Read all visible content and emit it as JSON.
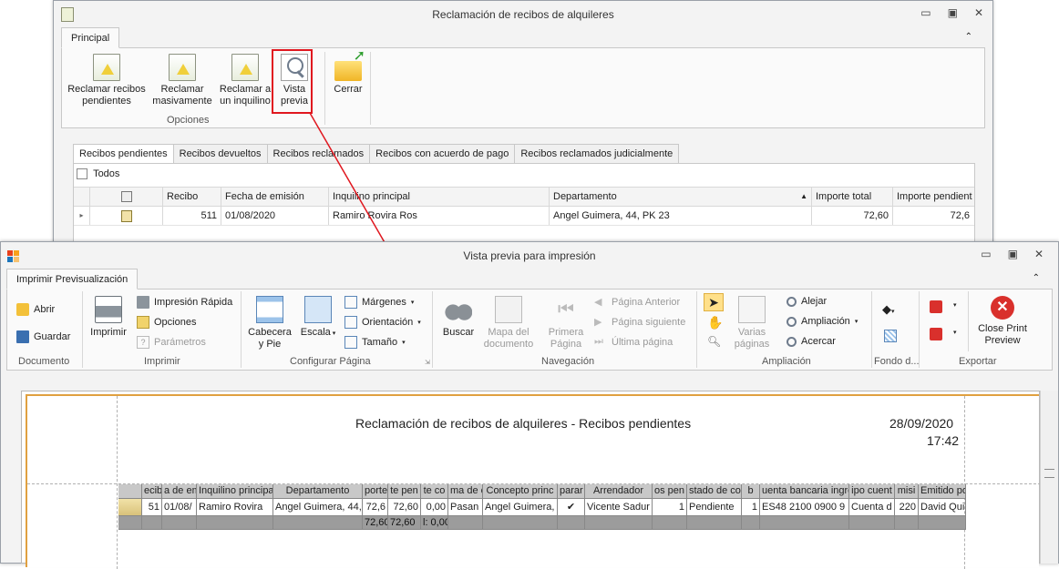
{
  "win1": {
    "title": "Reclamación de recibos  de alquileres",
    "tab": "Principal",
    "buttons": {
      "reclamar_pend": "Reclamar recibos pendientes",
      "reclamar_masivo": "Reclamar masivamente",
      "reclamar_inquilino": "Reclamar a un inquilino",
      "vista_previa": "Vista previa",
      "cerrar": "Cerrar"
    },
    "group": "Opciones",
    "subtabs": [
      "Recibos pendientes",
      "Recibos devueltos",
      "Recibos reclamados",
      "Recibos con acuerdo de pago",
      "Recibos reclamados judicialmente"
    ],
    "todos": "Todos",
    "columns": [
      "Recibo",
      "Fecha de emisión",
      "Inquilino principal",
      "Departamento",
      "Importe total",
      "Importe pendient"
    ],
    "sort_icon": "▲",
    "row": {
      "recibo": "511",
      "fecha": "01/08/2020",
      "inquilino": "Ramiro Rovira Ros",
      "departamento": "Angel Guimera, 44, PK 23",
      "importe_total": "72,60",
      "importe_pendiente": "72,6"
    }
  },
  "win2": {
    "title": "Vista previa para impresión",
    "tab": "Imprimir Previsualización",
    "documento": {
      "abrir": "Abrir",
      "guardar": "Guardar",
      "label": "Documento"
    },
    "imprimir": {
      "imprimir": "Imprimir",
      "rapida": "Impresión Rápida",
      "opciones": "Opciones",
      "parametros": "Parámetros",
      "label": "Imprimir"
    },
    "configurar": {
      "cabecera": "Cabecera y Pie",
      "escala": "Escala",
      "margenes": "Márgenes",
      "orientacion": "Orientación",
      "tamano": "Tamaño",
      "label": "Configurar Página"
    },
    "navegacion": {
      "buscar": "Buscar",
      "mapa": "Mapa del documento",
      "primera": "Primera Página",
      "anterior": "Página Anterior",
      "siguiente": "Página siguiente",
      "ultima": "Última página",
      "label": "Navegación"
    },
    "ampliacion": {
      "varias": "Varias páginas",
      "alejar": "Alejar",
      "ampliacion": "Ampliación",
      "acercar": "Acercar",
      "label": "Ampliación"
    },
    "fondo": {
      "label": "Fondo d..."
    },
    "exportar": {
      "close": "Close Print Preview",
      "label": "Exportar"
    }
  },
  "report": {
    "title": "Reclamación de recibos de alquileres - Recibos pendientes",
    "date": "28/09/2020",
    "time": "17:42",
    "headers": [
      "",
      "ecib",
      "a de em",
      "Inquilino principa",
      "Departamento",
      "porte t",
      "te pen",
      "te co",
      "ma de c",
      "Concepto princ",
      "parar fa",
      "Arrendador",
      "os pen",
      "stado de co",
      "b",
      "uenta bancaria ingre",
      "ipo cuent",
      "misi",
      "Emitido po"
    ],
    "row": [
      "",
      "51",
      "01/08/",
      "Ramiro Rovira",
      "Angel Guimera, 44,",
      "72,6",
      "72,60",
      "0,00",
      "Pasan",
      "Angel Guimera,",
      "✔",
      "Vicente Sadur",
      "1",
      "Pendiente",
      "1",
      "ES48 2100 0900 9",
      "Cuenta d",
      "220",
      "David Qui"
    ],
    "totals": [
      "",
      "",
      "",
      "",
      "",
      "72,60:",
      "72,60",
      "l: 0,00",
      "",
      "",
      "",
      "",
      "",
      "",
      "",
      "",
      "",
      "",
      ""
    ]
  },
  "colors": {
    "highlight": "#e0171f",
    "page_border": "#e0a040",
    "close_red": "#d9302c"
  }
}
